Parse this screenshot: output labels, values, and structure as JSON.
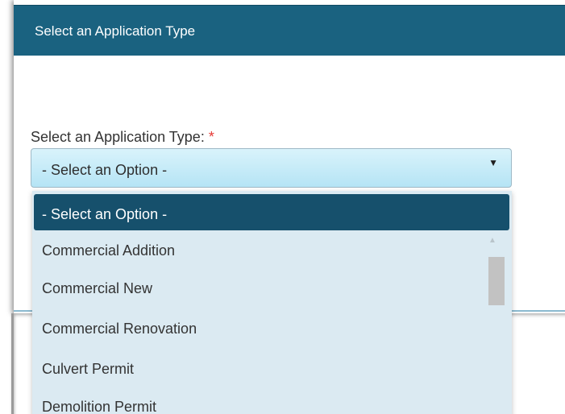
{
  "header": {
    "title": "Select an Application Type"
  },
  "form": {
    "label": "Select an Application Type:",
    "required_marker": "*",
    "selected_value": "- Select an Option -"
  },
  "dropdown": {
    "highlighted_option": "- Select an Option -",
    "options": [
      "Commercial Addition",
      "Commercial New",
      "Commercial Renovation",
      "Culvert Permit",
      "Demolition Permit"
    ]
  },
  "colors": {
    "header_bg": "#1a6280",
    "selected_option_bg": "#16506c",
    "select_bg": "#b5e4f5",
    "required": "#e53935"
  },
  "icons": {
    "select_arrow": "chevron-down-icon",
    "scroll_up": "scroll-up-arrow-icon"
  }
}
